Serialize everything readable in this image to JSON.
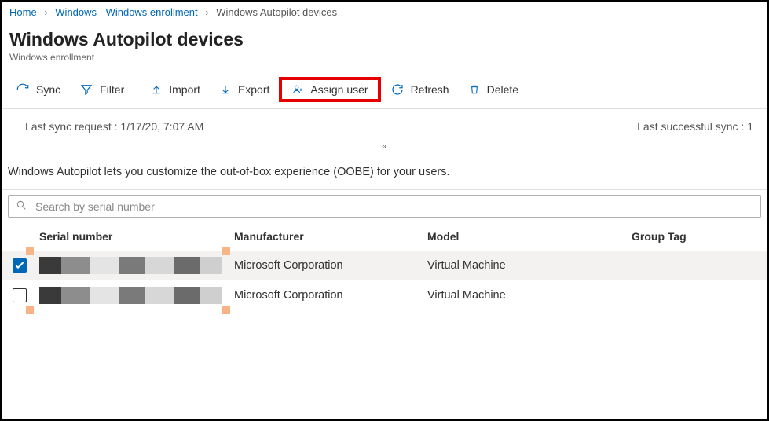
{
  "breadcrumb": {
    "home": "Home",
    "parent": "Windows - Windows enrollment",
    "current": "Windows Autopilot devices"
  },
  "page": {
    "title": "Windows Autopilot devices",
    "subtitle": "Windows enrollment"
  },
  "toolbar": {
    "sync": "Sync",
    "filter": "Filter",
    "import": "Import",
    "export": "Export",
    "assign_user": "Assign user",
    "refresh": "Refresh",
    "delete": "Delete"
  },
  "status": {
    "last_sync_label": "Last sync request  :",
    "last_sync_value": "1/17/20, 7:07 AM",
    "last_success_label": "Last successful sync  :",
    "last_success_value": "1"
  },
  "description": "Windows Autopilot lets you customize the out-of-box experience (OOBE) for your users.",
  "search": {
    "placeholder": "Search by serial number"
  },
  "table": {
    "headers": {
      "serial": "Serial number",
      "manufacturer": "Manufacturer",
      "model": "Model",
      "group_tag": "Group Tag"
    },
    "rows": [
      {
        "selected": true,
        "serial": "",
        "manufacturer": "Microsoft Corporation",
        "model": "Virtual Machine",
        "group_tag": ""
      },
      {
        "selected": false,
        "serial": "",
        "manufacturer": "Microsoft Corporation",
        "model": "Virtual Machine",
        "group_tag": ""
      }
    ]
  }
}
